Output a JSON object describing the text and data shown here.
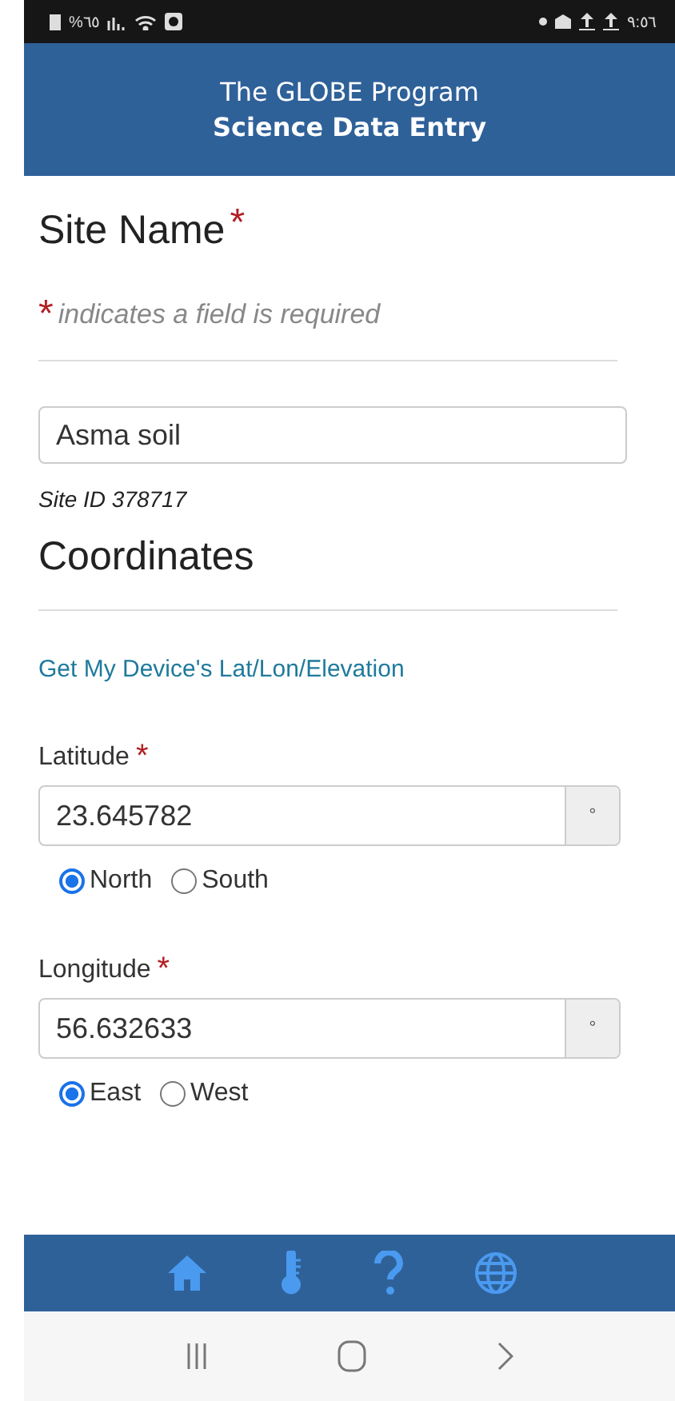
{
  "status_bar": {
    "battery": "%٦٥",
    "time": "٩:٥٦"
  },
  "header": {
    "title": "The GLOBE Program",
    "subtitle": "Science Data Entry"
  },
  "site_name": {
    "heading": "Site Name",
    "required": true,
    "required_mark": "*",
    "note": "indicates a field is required",
    "value": "Asma soil",
    "site_id": "Site ID 378717"
  },
  "coordinates": {
    "heading": "Coordinates",
    "link": "Get My Device's Lat/Lon/Elevation",
    "fields": [
      {
        "label": "Latitude",
        "required": true,
        "value": "23.645782",
        "unit": "°",
        "options": [
          {
            "label": "North",
            "selected": true
          },
          {
            "label": "South",
            "selected": false
          }
        ]
      },
      {
        "label": "Longitude",
        "required": true,
        "value": "56.632633",
        "unit": "°",
        "options": [
          {
            "label": "East",
            "selected": true
          },
          {
            "label": "West",
            "selected": false
          }
        ]
      }
    ]
  },
  "bottom_nav": [
    {
      "kind": "home"
    },
    {
      "kind": "thermometer"
    },
    {
      "kind": "help"
    },
    {
      "kind": "globe"
    }
  ]
}
